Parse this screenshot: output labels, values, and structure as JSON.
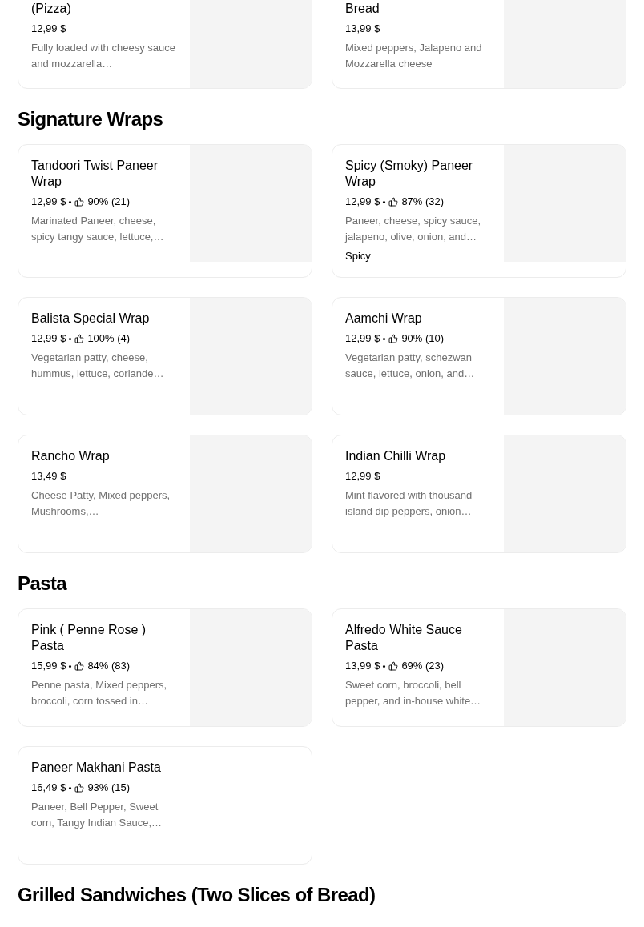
{
  "sections": [
    {
      "items": [
        {
          "name": "(Pizza)",
          "price": "12,99 $",
          "description": "Fully loaded with cheesy sauce and mozzarella…"
        },
        {
          "name": "Bread",
          "price": "13,99 $",
          "description": "Mixed peppers, Jalapeno and Mozzarella cheese"
        }
      ]
    },
    {
      "title": "Signature Wraps",
      "items": [
        {
          "name": "Tandoori Twist Paneer Wrap",
          "price": "12,99 $",
          "rating": "90% (21)",
          "description": "Marinated Paneer, cheese, spicy tangy sauce, lettuce,…"
        },
        {
          "name": "Spicy (Smoky) Paneer Wrap",
          "price": "12,99 $",
          "rating": "87% (32)",
          "description": "Paneer, cheese, spicy sauce, jalapeno, olive, onion, and…",
          "tag": "Spicy"
        },
        {
          "name": "Balista Special Wrap",
          "price": "12,99 $",
          "rating": "100% (4)",
          "description": "Vegetarian patty, cheese, hummus, lettuce, coriande…"
        },
        {
          "name": "Aamchi Wrap",
          "price": "12,99 $",
          "rating": "90% (10)",
          "description": "Vegetarian patty, schezwan sauce, lettuce, onion, and…"
        },
        {
          "name": "Rancho Wrap",
          "price": "13,49 $",
          "description": "Cheese Patty, Mixed peppers, Mushrooms,…"
        },
        {
          "name": "Indian Chilli Wrap",
          "price": "12,99 $",
          "description": "Mint flavored with thousand island dip peppers, onion…"
        }
      ]
    },
    {
      "title": "Pasta",
      "items": [
        {
          "name": "Pink ( Penne Rose ) Pasta",
          "price": "15,99 $",
          "rating": "84% (83)",
          "description": "Penne pasta, Mixed peppers, broccoli, corn tossed in…"
        },
        {
          "name": "Alfredo White Sauce Pasta",
          "price": "13,99 $",
          "rating": "69% (23)",
          "description": "Sweet corn, broccoli, bell pepper, and in-house white…"
        },
        {
          "name": "Paneer Makhani Pasta",
          "price": "16,49 $",
          "rating": "93% (15)",
          "description": "Paneer, Bell Pepper, Sweet corn, Tangy Indian Sauce,…"
        }
      ]
    },
    {
      "title": "Grilled Sandwiches (Two Slices of Bread)"
    }
  ]
}
